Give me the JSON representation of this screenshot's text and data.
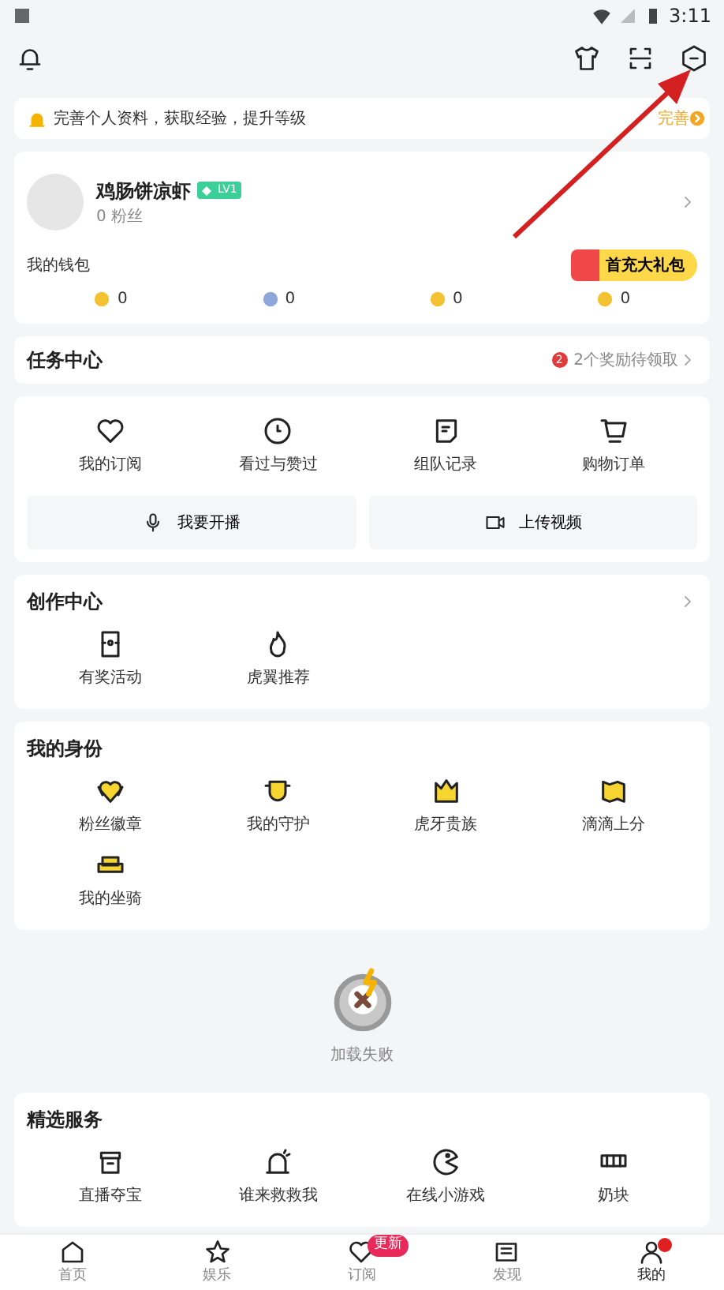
{
  "status_bar": {
    "time": "3:11"
  },
  "banner": {
    "text": "完善个人资料，获取经验，提升等级",
    "action": "完善"
  },
  "profile": {
    "name": "鸡肠饼凉虾",
    "level": "LV1",
    "fans": "0 粉丝",
    "wallet_label": "我的钱包",
    "gift": "首充大礼包",
    "wallet": [
      {
        "value": "0",
        "color": "#f2c230"
      },
      {
        "value": "0",
        "color": "#8fa6d8"
      },
      {
        "value": "0",
        "color": "#f2c230"
      },
      {
        "value": "0",
        "color": "#f2c230"
      }
    ]
  },
  "task_center": {
    "title": "任务中心",
    "badge": "2",
    "note": "2个奖励待领取"
  },
  "shortcuts": [
    {
      "label": "我的订阅"
    },
    {
      "label": "看过与赞过"
    },
    {
      "label": "组队记录"
    },
    {
      "label": "购物订单"
    }
  ],
  "actions": [
    {
      "label": "我要开播"
    },
    {
      "label": "上传视频"
    }
  ],
  "creation": {
    "title": "创作中心",
    "items": [
      {
        "label": "有奖活动"
      },
      {
        "label": "虎翼推荐"
      }
    ]
  },
  "identity": {
    "title": "我的身份",
    "items": [
      {
        "label": "粉丝徽章"
      },
      {
        "label": "我的守护"
      },
      {
        "label": "虎牙贵族"
      },
      {
        "label": "滴滴上分"
      },
      {
        "label": "我的坐骑"
      }
    ]
  },
  "load_failed": {
    "text": "加载失败"
  },
  "services": {
    "title": "精选服务",
    "items": [
      {
        "label": "直播夺宝"
      },
      {
        "label": "谁来救救我"
      },
      {
        "label": "在线小游戏"
      },
      {
        "label": "奶块"
      }
    ]
  },
  "bottom_nav": [
    {
      "label": "首页",
      "selected": false
    },
    {
      "label": "娱乐",
      "selected": false
    },
    {
      "label": "订阅",
      "selected": false,
      "badge": "更新"
    },
    {
      "label": "发现",
      "selected": false
    },
    {
      "label": "我的",
      "selected": true,
      "dot": true
    }
  ]
}
